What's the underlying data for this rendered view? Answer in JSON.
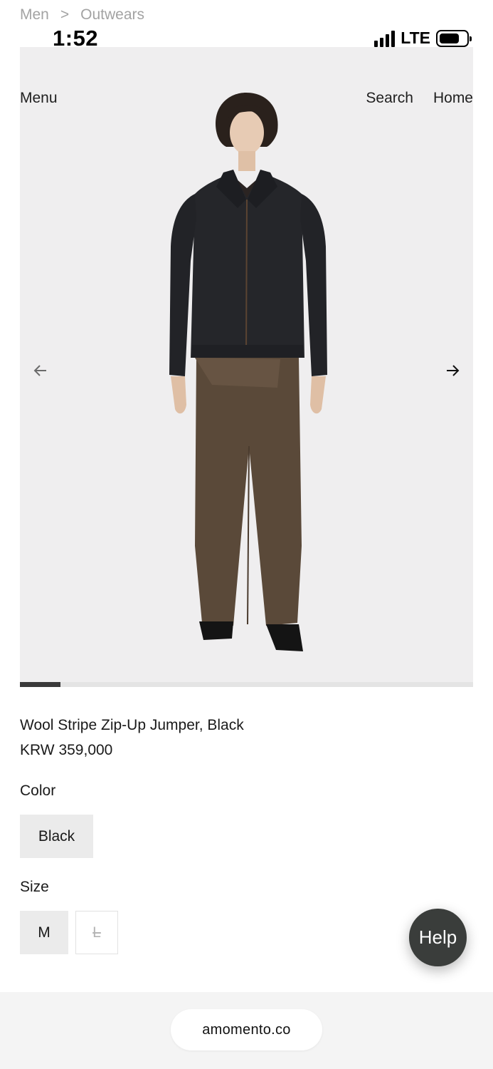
{
  "breadcrumb": {
    "parent": "Men",
    "separator": ">",
    "current": "Outwears"
  },
  "status": {
    "time": "1:52",
    "network": "LTE"
  },
  "nav": {
    "menu": "Menu",
    "search": "Search",
    "home": "Home"
  },
  "gallery": {
    "icons": {
      "prev": "arrow-left-icon",
      "next": "arrow-right-icon"
    },
    "progress": 0.09
  },
  "product": {
    "title": "Wool Stripe Zip-Up Jumper, Black",
    "price": "KRW 359,000"
  },
  "color": {
    "label": "Color",
    "options": [
      "Black"
    ],
    "selected": "Black"
  },
  "size": {
    "label": "Size",
    "options": [
      "M",
      "L"
    ],
    "selected": "M",
    "unavailable": [
      "L"
    ]
  },
  "help": {
    "label": "Help"
  },
  "browser": {
    "url": "amomento.co"
  },
  "colors": {
    "gallery_bg": "#efeeef",
    "selected_option_bg": "#ebebeb",
    "help_bg": "#3a3d3b",
    "jacket": "#25262a",
    "trousers": "#5a4939"
  }
}
